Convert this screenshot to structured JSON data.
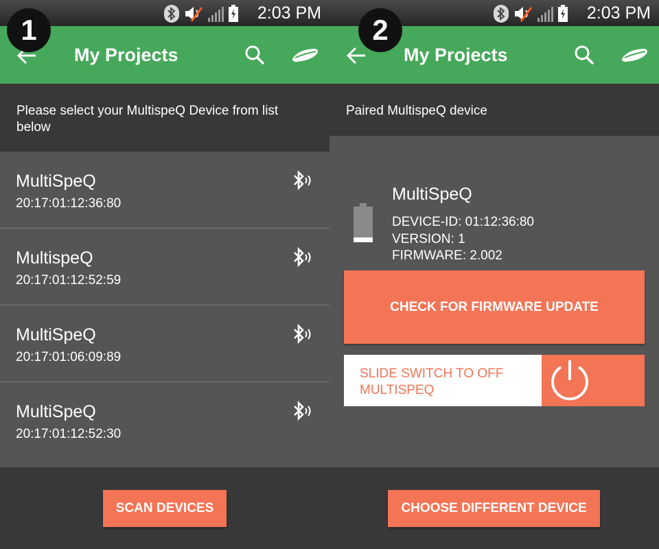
{
  "status": {
    "time": "2:03 PM"
  },
  "screens": [
    {
      "badge": "1",
      "title": "My Projects",
      "subheader": "Please select your MultispeQ Device from list below",
      "devices": [
        {
          "name": "MultiSpeQ",
          "mac": "20:17:01:12:36:80"
        },
        {
          "name": "MultispeQ",
          "mac": "20:17:01:12:52:59"
        },
        {
          "name": "MultiSpeQ",
          "mac": "20:17:01:06:09:89"
        },
        {
          "name": "MultiSpeQ",
          "mac": "20:17:01:12:52:30"
        }
      ],
      "footer_button": "SCAN DEVICES"
    },
    {
      "badge": "2",
      "title": "My Projects",
      "subheader": "Paired MultispeQ device",
      "device": {
        "name": "MultiSpeQ",
        "device_id": "DEVICE-ID: 01:12:36:80",
        "version": "VERSION: 1",
        "firmware": "FIRMWARE: 2.002"
      },
      "firmware_button": "CHECK FOR FIRMWARE UPDATE",
      "slide_switch_label": "SLIDE SWITCH TO OFF MULTISPEQ",
      "footer_button": "CHOOSE DIFFERENT DEVICE"
    }
  ],
  "colors": {
    "appbar": "#46a85a",
    "accent": "#f47456",
    "background": "#555555",
    "dark_panel": "#383838"
  },
  "icons": [
    "back-arrow-icon",
    "search-icon",
    "spaceship-icon",
    "bluetooth-icon",
    "battery-icon",
    "power-icon",
    "mute-icon",
    "signal-icon"
  ]
}
